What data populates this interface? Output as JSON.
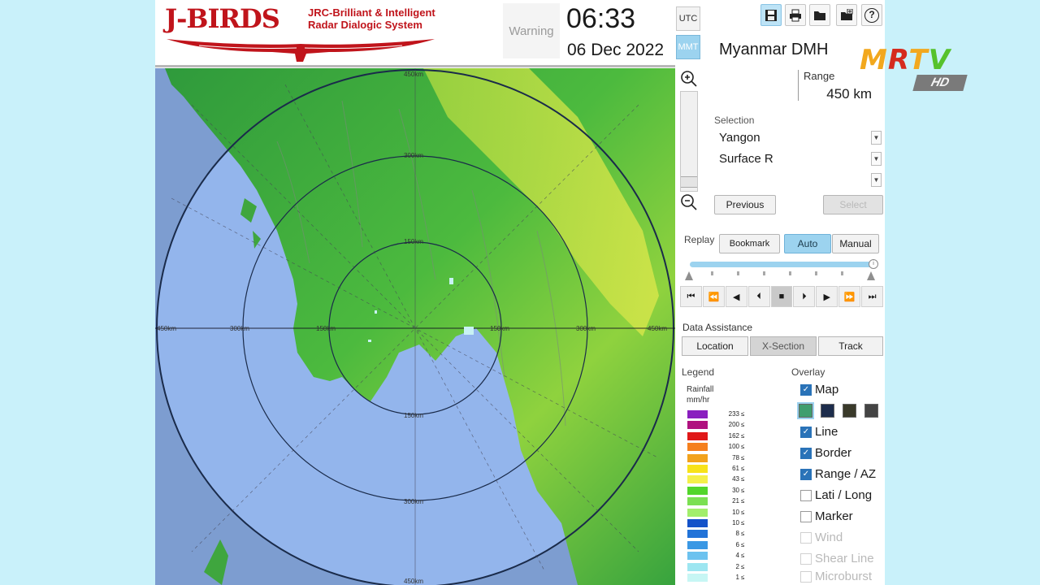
{
  "logo": {
    "title": "J-BIRDS",
    "subtitle": "JRC-Brilliant & Intelligent\nRadar Dialogic System"
  },
  "header": {
    "warning": "Warning",
    "time": "06:33",
    "date": "06 Dec 2022",
    "tz_utc": "UTC",
    "tz_mmt": "MMT",
    "active_tz": "MMT"
  },
  "toolbar": {
    "icons": [
      "save-icon",
      "print-icon",
      "folder-icon",
      "add-icon",
      "help-icon"
    ],
    "help_label": "?"
  },
  "station": "Myanmar DMH",
  "range": {
    "label": "Range",
    "value": "450 km"
  },
  "selection": {
    "title": "Selection",
    "rows": [
      "Yangon",
      "Surface R",
      ""
    ],
    "previous_label": "Previous",
    "select_label": "Select"
  },
  "replay": {
    "label": "Replay",
    "bookmark_label": "Bookmark",
    "auto_label": "Auto",
    "manual_label": "Manual",
    "mode": "Auto",
    "position": 1.0,
    "controls": [
      "⏮",
      "⏪",
      "◀",
      "⏴",
      "■",
      "⏵",
      "▶",
      "⏩",
      "⏭"
    ]
  },
  "data_assistance": {
    "title": "Data Assistance",
    "location_label": "Location",
    "xsection_label": "X-Section",
    "track_label": "Track"
  },
  "legend": {
    "title": "Legend",
    "unit": "Rainfall\nmm/hr",
    "items": [
      {
        "value": "233",
        "color": "#8a1fbf"
      },
      {
        "value": "200",
        "color": "#b0127f"
      },
      {
        "value": "162",
        "color": "#e01818"
      },
      {
        "value": "100",
        "color": "#f57f1d"
      },
      {
        "value": "78",
        "color": "#f2a21c"
      },
      {
        "value": "61",
        "color": "#f7e21a"
      },
      {
        "value": "43",
        "color": "#f4f04a"
      },
      {
        "value": "30",
        "color": "#52d62b"
      },
      {
        "value": "21",
        "color": "#7be052"
      },
      {
        "value": "10",
        "color": "#a2ee6c"
      },
      {
        "value": "10",
        "color": "#1352c9"
      },
      {
        "value": "8",
        "color": "#2273d8"
      },
      {
        "value": "6",
        "color": "#3a98e4"
      },
      {
        "value": "4",
        "color": "#6cc2ef"
      },
      {
        "value": "2",
        "color": "#9de6f1"
      },
      {
        "value": "1",
        "color": "#c7f6f4"
      }
    ],
    "le_symbol": "≤"
  },
  "overlay": {
    "title": "Overlay",
    "items": [
      {
        "label": "Map",
        "checked": true,
        "enabled": true
      },
      {
        "label": "Line",
        "checked": true,
        "enabled": true
      },
      {
        "label": "Border",
        "checked": true,
        "enabled": true
      },
      {
        "label": "Range / AZ",
        "checked": true,
        "enabled": true
      },
      {
        "label": "Lati / Long",
        "checked": false,
        "enabled": true
      },
      {
        "label": "Marker",
        "checked": false,
        "enabled": true
      },
      {
        "label": "Wind",
        "checked": false,
        "enabled": false
      },
      {
        "label": "Shear Line",
        "checked": false,
        "enabled": false
      },
      {
        "label": "Microburst",
        "checked": false,
        "enabled": false
      }
    ],
    "map_styles": [
      "#3f9e6e",
      "#1d2d4c",
      "#3a3a2a",
      "#444444"
    ]
  },
  "map": {
    "range_labels_top": [
      "450km",
      "300km"
    ],
    "range_labels_vertical": [
      "150km",
      "150km",
      "300km",
      "450km"
    ],
    "range_labels_horizontal": [
      "450km",
      "300km",
      "150km",
      "150km",
      "300km",
      "450km"
    ]
  },
  "watermark": {
    "brand_m": "M",
    "brand_r": "R",
    "brand_t": "T",
    "brand_v": "V",
    "hd": "HD"
  }
}
